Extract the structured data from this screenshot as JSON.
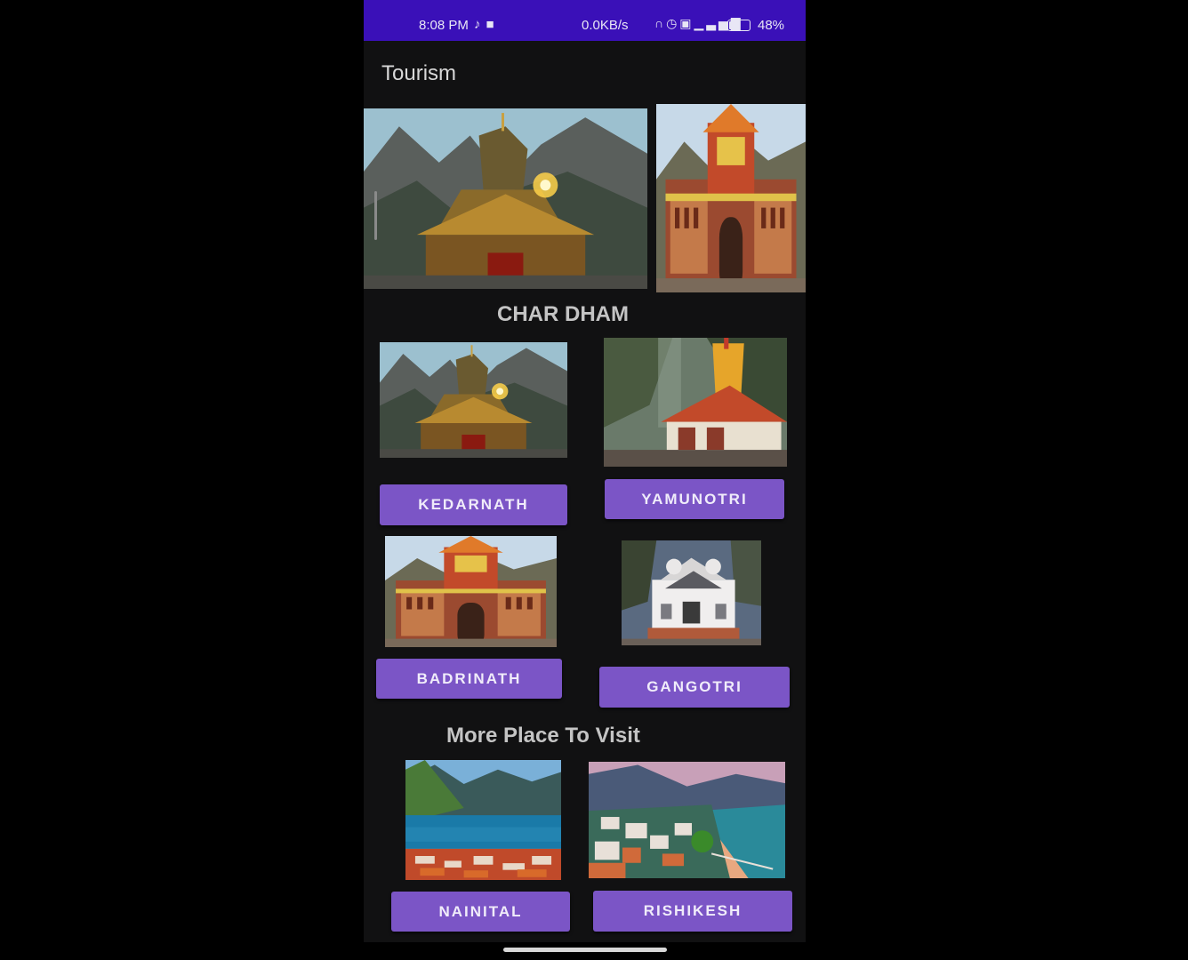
{
  "status_bar": {
    "time": "8:08 PM",
    "left_icons": [
      "tiktok-icon",
      "video-camera-icon"
    ],
    "network_speed": "0.0KB/s",
    "right_icons": [
      "headphones-icon",
      "alarm-icon",
      "volte-icon",
      "signal-icon"
    ],
    "battery": "48%",
    "battery_level": 0.48,
    "color": "#3a10b8"
  },
  "app_bar": {
    "title": "Tourism"
  },
  "carousel": {
    "images": [
      "kedarnath-temple-photo",
      "badrinath-temple-photo"
    ]
  },
  "char_dham": {
    "title": "CHAR DHAM",
    "items": [
      {
        "label": "KEDARNATH",
        "image": "kedarnath-temple-photo"
      },
      {
        "label": "YAMUNOTRI",
        "image": "yamunotri-temple-photo"
      },
      {
        "label": "BADRINATH",
        "image": "badrinath-temple-photo"
      },
      {
        "label": "GANGOTRI",
        "image": "gangotri-temple-photo"
      }
    ]
  },
  "more_places": {
    "title": "More Place To Visit",
    "items": [
      {
        "label": "NAINITAL",
        "image": "nainital-lake-photo"
      },
      {
        "label": "RISHIKESH",
        "image": "rishikesh-river-photo"
      }
    ]
  },
  "colors": {
    "button": "#7b55c6",
    "background": "#111112",
    "status_bar": "#3a10b8"
  }
}
